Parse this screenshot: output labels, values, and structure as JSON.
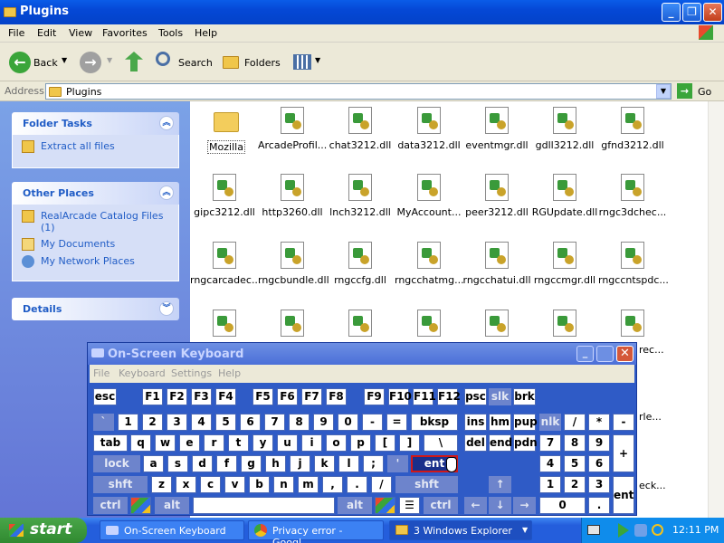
{
  "window": {
    "title": "Plugins"
  },
  "menu": [
    "File",
    "Edit",
    "View",
    "Favorites",
    "Tools",
    "Help"
  ],
  "toolbar": {
    "back": "Back",
    "search": "Search",
    "folders": "Folders"
  },
  "address": {
    "label": "Address",
    "value": "Plugins",
    "go": "Go"
  },
  "tasks": {
    "folder_tasks": {
      "title": "Folder Tasks",
      "items": [
        "Extract all files"
      ]
    },
    "other_places": {
      "title": "Other Places",
      "items": [
        "RealArcade Catalog Files (1)",
        "My Documents",
        "My Network Places"
      ]
    },
    "details": {
      "title": "Details"
    }
  },
  "files": {
    "row1": [
      "Mozilla",
      "ArcadeProfil...",
      "chat3212.dll",
      "data3212.dll",
      "eventmgr.dll",
      "gdll3212.dll",
      "gfnd3212.dll"
    ],
    "row2": [
      "gipc3212.dll",
      "http3260.dll",
      "lnch3212.dll",
      "MyAccount...",
      "peer3212.dll",
      "RGUpdate.dll",
      "rngc3dchec..."
    ],
    "row3": [
      "rngcarcadec...",
      "rngcbundle.dll",
      "rngccfg.dll",
      "rngcchatmg...",
      "rngcchatui.dll",
      "rngccmgr.dll",
      "rngccntspdc..."
    ],
    "partial": [
      "rec...",
      "rle...",
      "eck..."
    ]
  },
  "osk": {
    "title": "On-Screen Keyboard",
    "menu": [
      "File",
      "Keyboard",
      "Settings",
      "Help"
    ],
    "keys": {
      "r1": [
        "esc",
        "F1",
        "F2",
        "F3",
        "F4",
        "F5",
        "F6",
        "F7",
        "F8",
        "F9",
        "F10",
        "F11",
        "F12",
        "psc",
        "slk",
        "brk"
      ],
      "r2": [
        "`",
        "1",
        "2",
        "3",
        "4",
        "5",
        "6",
        "7",
        "8",
        "9",
        "0",
        "-",
        "=",
        "bksp",
        "ins",
        "hm",
        "pup",
        "nlk",
        "/",
        "*",
        "-"
      ],
      "r3": [
        "tab",
        "q",
        "w",
        "e",
        "r",
        "t",
        "y",
        "u",
        "i",
        "o",
        "p",
        "[",
        "]",
        "\\",
        "del",
        "end",
        "pdn",
        "7",
        "8",
        "9",
        "+"
      ],
      "r4": [
        "lock",
        "a",
        "s",
        "d",
        "f",
        "g",
        "h",
        "j",
        "k",
        "l",
        ";",
        "'",
        "ent",
        "4",
        "5",
        "6"
      ],
      "r5": [
        "shft",
        "z",
        "x",
        "c",
        "v",
        "b",
        "n",
        "m",
        ",",
        ".",
        "/",
        "shft",
        "↑",
        "1",
        "2",
        "3",
        "ent"
      ],
      "r6": [
        "ctrl",
        "alt",
        "alt",
        "ctrl",
        "←",
        "↓",
        "→",
        "0",
        "."
      ]
    }
  },
  "taskbar": {
    "start": "start",
    "buttons": [
      "On-Screen Keyboard",
      "Privacy error - Googl...",
      "3 Windows Explorer"
    ],
    "clock": "12:11 PM"
  }
}
